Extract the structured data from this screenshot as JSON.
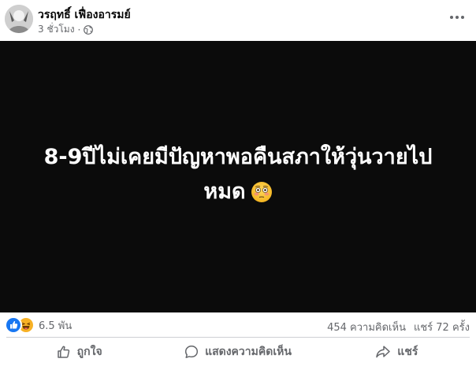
{
  "post": {
    "author": "วรฤทธิ์ เฟื่องอารมย์",
    "time": "3 ชั่วโมง",
    "separator": "·",
    "privacy_icon": "globe-icon",
    "more_icon": "more-horizontal-icon"
  },
  "media": {
    "line1": "8-9ปีไม่เคยมีปัญหาพอคืนสภาให้วุ่นวายไป",
    "line2": "หมด",
    "emoji": "flushed-face-emoji",
    "background": "#0b0b0b",
    "text_color": "#ffffff"
  },
  "reactions": {
    "icons": [
      "like-reaction-icon",
      "haha-reaction-icon"
    ],
    "count": "6.5 พัน",
    "comments": "454 ความคิดเห็น",
    "shares": "แชร์ 72 ครั้ง"
  },
  "actions": {
    "like": "ถูกใจ",
    "comment": "แสดงความคิดเห็น",
    "share": "แชร์"
  },
  "colors": {
    "like_blue": "#1877f2",
    "haha_yellow": "#f7b125",
    "secondary_text": "#65676b"
  }
}
